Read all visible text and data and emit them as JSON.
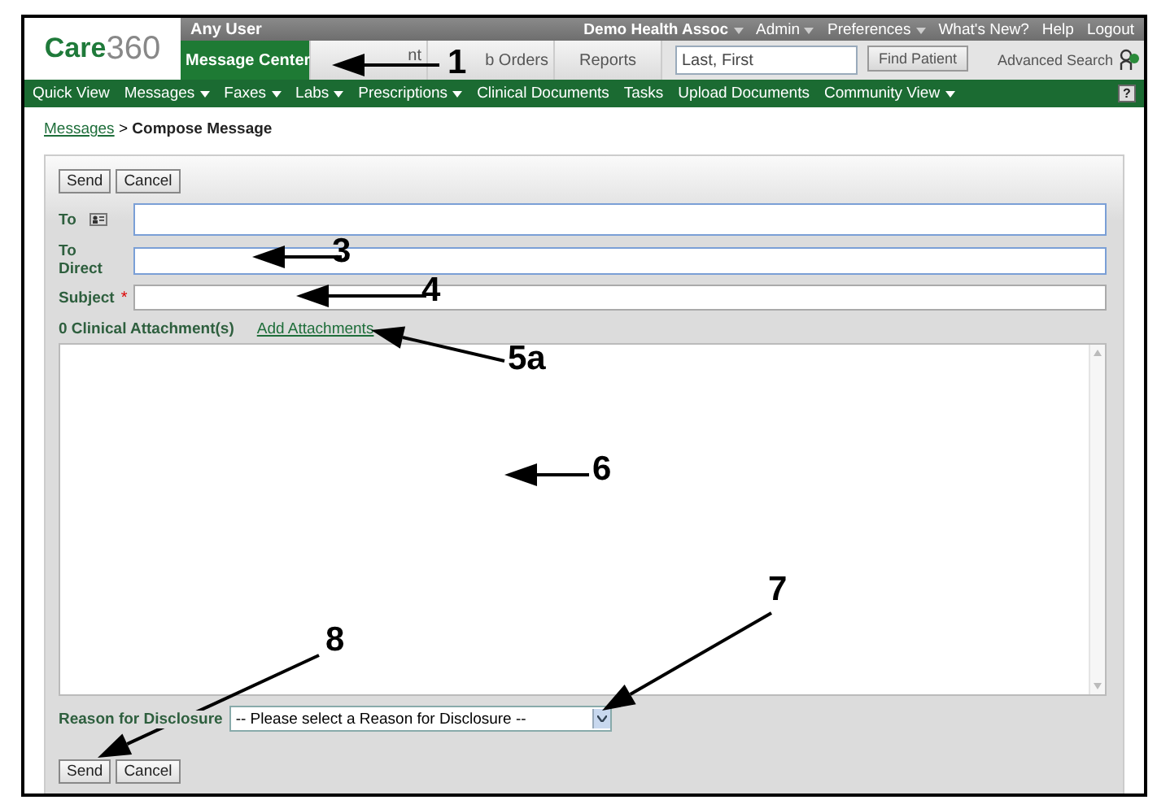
{
  "logo": {
    "text": "Care",
    "number": "360"
  },
  "user": "Any User",
  "top_links": [
    {
      "label": "Demo Health Assoc",
      "menu": true
    },
    {
      "label": "Admin",
      "menu": true
    },
    {
      "label": "Preferences",
      "menu": true
    },
    {
      "label": "What's New?",
      "menu": false
    },
    {
      "label": "Help",
      "menu": false
    },
    {
      "label": "Logout",
      "menu": false
    }
  ],
  "tabs": [
    {
      "label": "Message Center",
      "selected": true
    },
    {
      "label": "nt",
      "selected": false
    },
    {
      "label": "b Orders",
      "selected": false
    },
    {
      "label": "Reports",
      "selected": false
    }
  ],
  "patient_search": {
    "placeholder": "Last, First",
    "button": "Find Patient",
    "advanced": "Advanced Search"
  },
  "nav": [
    {
      "label": "Quick View",
      "menu": false
    },
    {
      "label": "Messages",
      "menu": true
    },
    {
      "label": "Faxes",
      "menu": true
    },
    {
      "label": "Labs",
      "menu": true
    },
    {
      "label": "Prescriptions",
      "menu": true
    },
    {
      "label": "Clinical Documents",
      "menu": false
    },
    {
      "label": "Tasks",
      "menu": false
    },
    {
      "label": "Upload Documents",
      "menu": false
    },
    {
      "label": "Community View",
      "menu": true
    }
  ],
  "help": "?",
  "breadcrumb": {
    "link": "Messages",
    "separator": ">",
    "current": "Compose Message"
  },
  "buttons_top": [
    "Send",
    "Cancel"
  ],
  "fields": [
    {
      "label": "To",
      "address_book": true,
      "required": false
    },
    {
      "label": "To Direct",
      "address_book": false,
      "required": false
    },
    {
      "label": "Subject",
      "address_book": false,
      "required": true
    }
  ],
  "required_mark": "*",
  "attachments": {
    "count": "0 Clinical Attachment(s)",
    "link": "Add Attachments"
  },
  "reason": {
    "label": "Reason for Disclosure",
    "value": "-- Please select a Reason for Disclosure --"
  },
  "buttons_bottom": [
    "Send",
    "Cancel"
  ],
  "callouts": [
    {
      "label": "1"
    },
    {
      "label": "3"
    },
    {
      "label": "4"
    },
    {
      "label": "5a"
    },
    {
      "label": "6"
    },
    {
      "label": "7"
    },
    {
      "label": "8"
    }
  ]
}
